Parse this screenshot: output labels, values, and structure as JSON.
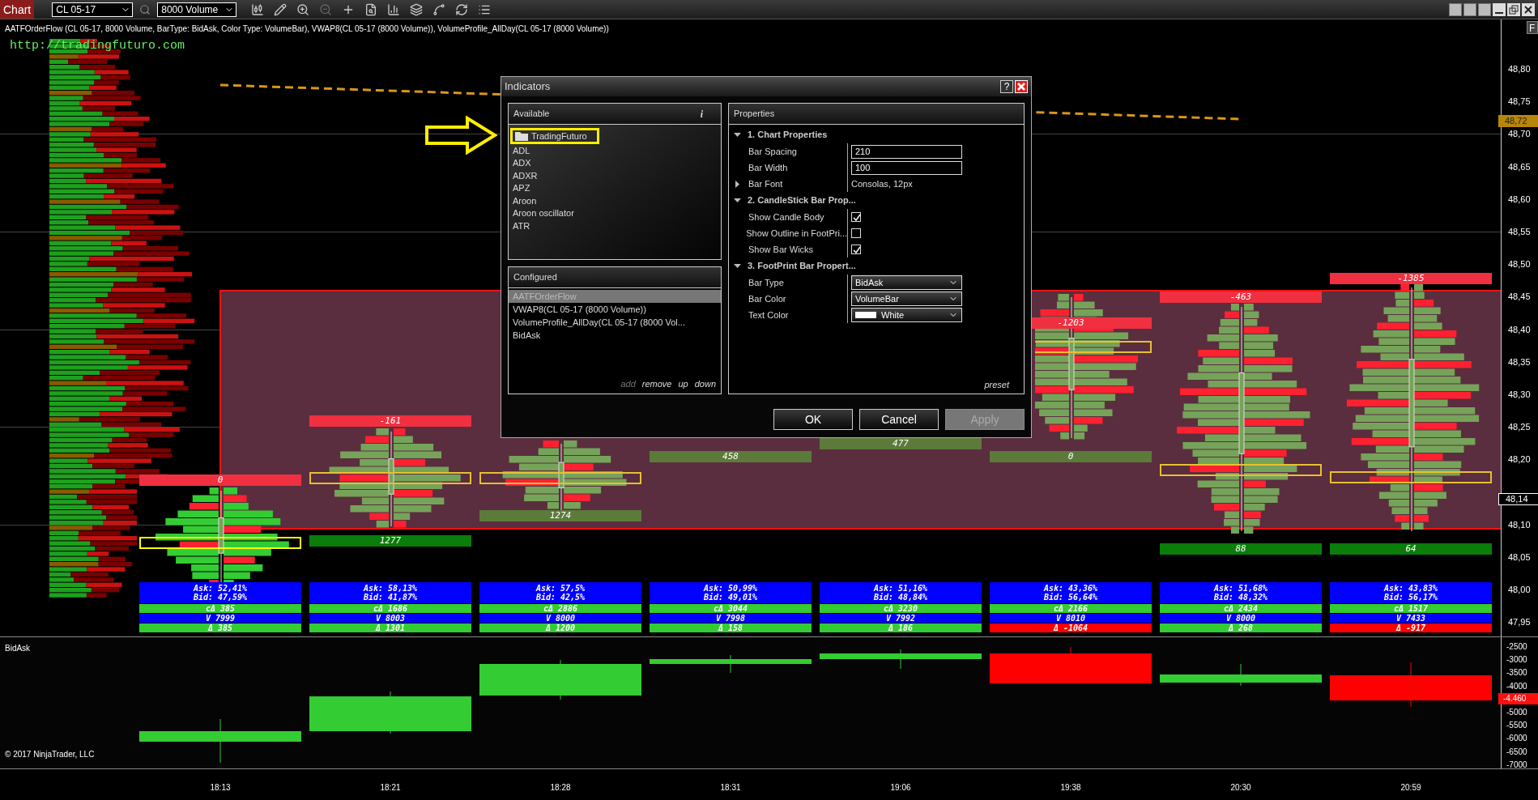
{
  "toolbar": {
    "title": "Chart",
    "instrument": "CL 05-17",
    "period": "8000 Volume"
  },
  "chart": {
    "caption": "AATFOrderFlow (CL 05-17, 8000 Volume, BarType: BidAsk, Color Type: VolumeBar), VWAP8(CL 05-17 (8000 Volume)), VolumeProfile_AllDay(CL 05-17 (8000 Volume))",
    "url": "http://tradingfuturo.com",
    "side_button": "F",
    "price_axis": [
      "48,80",
      "48,75",
      "48,70",
      "48,65",
      "48,60",
      "48,55",
      "48,50",
      "48,45",
      "48,40",
      "48,35",
      "48,30",
      "48,25",
      "48,20",
      "48,10",
      "48,05",
      "48,00",
      "47,95"
    ],
    "last_price_tag": "48,72",
    "cursor_price_tag": "48,14",
    "columns": [
      {
        "time": "18:13",
        "top_label": "0",
        "stats": {
          "ask": "Ask: 52,41%",
          "bid": "Bid: 47,59%",
          "cum_delta": "cΔ 385",
          "volume": "V 7999",
          "delta": {
            "text": "Δ 385",
            "color": "#33cc33"
          }
        }
      },
      {
        "time": "18:21",
        "top_label": "-161",
        "bottom_label": {
          "text": "1277",
          "color": "#0a7d0a"
        },
        "stats": {
          "ask": "Ask: 58,13%",
          "bid": "Bid: 41,87%",
          "cum_delta": "cΔ 1686",
          "volume": "V 8003",
          "delta": {
            "text": "Δ 1301",
            "color": "#33cc33"
          }
        }
      },
      {
        "time": "18:28",
        "bottom_label": {
          "text": "1274",
          "color": "#5c7a3a"
        },
        "stats": {
          "ask": "Ask: 57,5%",
          "bid": "Bid: 42,5%",
          "cum_delta": "cΔ 2886",
          "volume": "V 8000",
          "delta": {
            "text": "Δ 1200",
            "color": "#33cc33"
          }
        }
      },
      {
        "time": "18:31",
        "bottom_label": {
          "text": "458",
          "color": "#5c7a3a"
        },
        "stats": {
          "ask": "Ask: 50,99%",
          "bid": "Bid: 49,01%",
          "cum_delta": "cΔ 3044",
          "volume": "V 7998",
          "delta": {
            "text": "Δ 158",
            "color": "#33cc33"
          }
        }
      },
      {
        "time": "19:06",
        "bottom_label": {
          "text": "477",
          "color": "#5c7a3a"
        },
        "stats": {
          "ask": "Ask: 51,16%",
          "bid": "Bid: 48,84%",
          "cum_delta": "cΔ 3230",
          "volume": "V 7992",
          "delta": {
            "text": "Δ 186",
            "color": "#33cc33"
          }
        }
      },
      {
        "time": "19:38",
        "top_label": "-1203",
        "bottom_label": {
          "text": "0",
          "color": "#5c7a3a"
        },
        "stats": {
          "ask": "Ask: 43,36%",
          "bid": "Bid: 56,64%",
          "cum_delta": "cΔ 2166",
          "volume": "V 8010",
          "delta": {
            "text": "Δ -1064",
            "color": "#ff0000"
          }
        }
      },
      {
        "time": "20:30",
        "top_label": "-463",
        "bottom_label": {
          "text": "88",
          "color": "#0a7d0a"
        },
        "stats": {
          "ask": "Ask: 51,68%",
          "bid": "Bid: 48,32%",
          "cum_delta": "cΔ 2434",
          "volume": "V 8000",
          "delta": {
            "text": "Δ 268",
            "color": "#33cc33"
          }
        }
      },
      {
        "time": "20:59",
        "top_label": "-1385",
        "bottom_label": {
          "text": "64",
          "color": "#0a7d0a"
        },
        "stats": {
          "ask": "Ask: 43,83%",
          "bid": "Bid: 56,17%",
          "cum_delta": "cΔ 1517",
          "volume": "V 7433",
          "delta": {
            "text": "Δ -917",
            "color": "#ff0000"
          }
        }
      }
    ]
  },
  "lower_panel": {
    "title": "BidAsk",
    "copyright": "© 2017 NinjaTrader, LLC",
    "axis": [
      "-2500",
      "-3000",
      "-3500",
      "-4000",
      "-5000",
      "-5500",
      "-6000",
      "-6500",
      "-7000"
    ],
    "value_tag": "-4.460"
  },
  "dialog": {
    "title": "Indicators",
    "help": "?",
    "available": {
      "title": "Available",
      "info": "i",
      "items": [
        {
          "label": "TradingFuturo",
          "kind": "folder",
          "highlighted": true
        },
        {
          "label": "ADL",
          "kind": "item",
          "highlighted": false
        },
        {
          "label": "ADX",
          "kind": "item",
          "highlighted": false
        },
        {
          "label": "ADXR",
          "kind": "item",
          "highlighted": false
        },
        {
          "label": "APZ",
          "kind": "item",
          "highlighted": false
        },
        {
          "label": "Aroon",
          "kind": "item",
          "highlighted": false
        },
        {
          "label": "Aroon oscillator",
          "kind": "item",
          "highlighted": false
        },
        {
          "label": "ATR",
          "kind": "item",
          "highlighted": false
        }
      ]
    },
    "configured": {
      "title": "Configured",
      "items": [
        {
          "label": "AATFOrderFlow",
          "selected": true
        },
        {
          "label": "VWAP8(CL 05-17 (8000 Volume))",
          "selected": false
        },
        {
          "label": "VolumeProfile_AllDay(CL 05-17 (8000 Vol...",
          "selected": false
        },
        {
          "label": "BidAsk",
          "selected": false
        }
      ],
      "actions": [
        {
          "label": "add",
          "disabled": true
        },
        {
          "label": "remove",
          "disabled": false
        },
        {
          "label": "up",
          "disabled": false
        },
        {
          "label": "down",
          "disabled": false
        }
      ]
    },
    "properties": {
      "title": "Properties",
      "preset": "preset",
      "groups": [
        {
          "title": "1. Chart Properties",
          "expanded": true,
          "rows": [
            {
              "label": "Bar Spacing",
              "kind": "input",
              "value": "210"
            },
            {
              "label": "Bar Width",
              "kind": "input",
              "value": "100"
            },
            {
              "label": "Bar Font",
              "kind": "text",
              "value": "Consolas, 12px",
              "expanded": false
            }
          ]
        },
        {
          "title": "2. CandleStick Bar Prop...",
          "expanded": true,
          "rows": [
            {
              "label": "Show Candle Body",
              "kind": "checkbox",
              "checked": true
            },
            {
              "label": "Show Outline in FootPri...",
              "kind": "checkbox",
              "checked": false
            },
            {
              "label": "Show Bar Wicks",
              "kind": "checkbox",
              "checked": true
            }
          ]
        },
        {
          "title": "3. FootPrint Bar Propert...",
          "expanded": true,
          "rows": [
            {
              "label": "Bar Type",
              "kind": "select",
              "value": "BidAsk"
            },
            {
              "label": "Bar Color",
              "kind": "select",
              "value": "VolumeBar"
            },
            {
              "label": "Text Color",
              "kind": "select",
              "value": "White",
              "color": "#ffffff"
            }
          ]
        }
      ]
    },
    "buttons": [
      {
        "label": "OK",
        "disabled": false
      },
      {
        "label": "Cancel",
        "disabled": false
      },
      {
        "label": "Apply",
        "disabled": true
      }
    ]
  }
}
